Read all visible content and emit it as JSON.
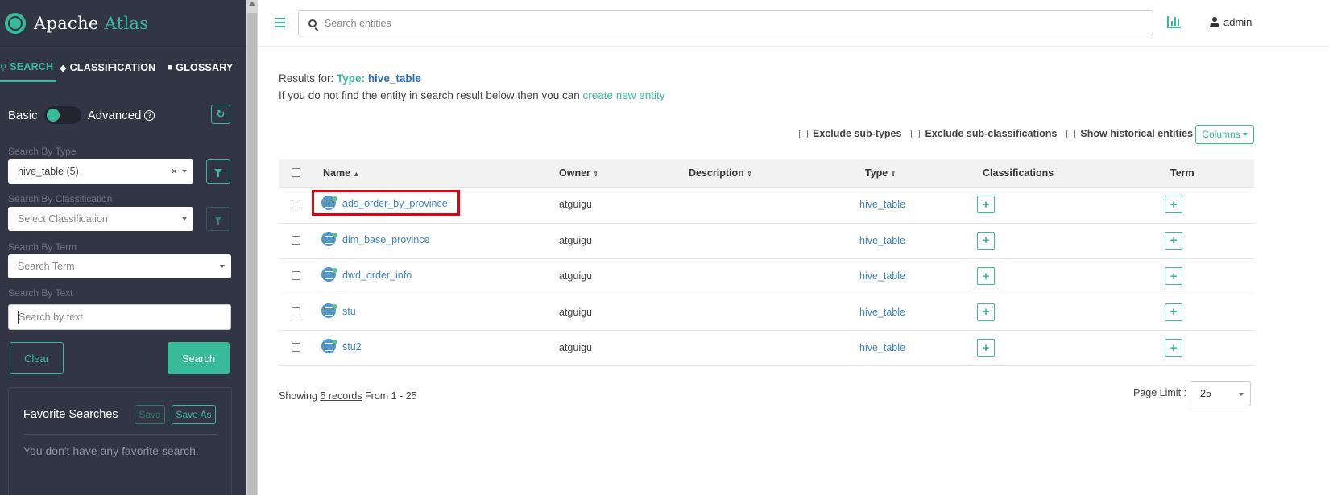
{
  "brand": {
    "name_part1": "Apache ",
    "name_part2": "Atlas"
  },
  "sidebar": {
    "tabs": [
      {
        "label": "SEARCH",
        "icon": "search-icon"
      },
      {
        "label": "CLASSIFICATION",
        "icon": "tag-icon"
      },
      {
        "label": "GLOSSARY",
        "icon": "folder-open-icon"
      }
    ],
    "mode": {
      "basic_label": "Basic",
      "advanced_label": "Advanced"
    },
    "search_by_type_label": "Search By Type",
    "type_value": "hive_table (5)",
    "search_by_classification_label": "Search By Classification",
    "classification_placeholder": "Select Classification",
    "search_by_term_label": "Search By Term",
    "term_placeholder": "Search Term",
    "search_by_text_label": "Search By Text",
    "text_placeholder": "Search by text",
    "clear_label": "Clear",
    "search_label": "Search",
    "favorites": {
      "title": "Favorite Searches",
      "save_label": "Save",
      "save_as_label": "Save As",
      "empty_text": "You don't have any favorite search."
    }
  },
  "header": {
    "search_placeholder": "Search entities",
    "user_label": "admin"
  },
  "results": {
    "prefix": "Results for: ",
    "type_key": "Type:",
    "type_value": "hive_table",
    "hint_text": "If you do not find the entity in search result below then you can ",
    "hint_link": "create new entity",
    "options": [
      "Exclude sub-types",
      "Exclude sub-classifications",
      "Show historical entities"
    ],
    "columns_label": "Columns"
  },
  "table": {
    "headers": [
      "Name",
      "Owner",
      "Description",
      "Type",
      "Classifications",
      "Term"
    ],
    "rows": [
      {
        "name": "ads_order_by_province",
        "owner": "atguigu",
        "description": "",
        "type": "hive_table"
      },
      {
        "name": "dim_base_province",
        "owner": "atguigu",
        "description": "",
        "type": "hive_table"
      },
      {
        "name": "dwd_order_info",
        "owner": "atguigu",
        "description": "",
        "type": "hive_table"
      },
      {
        "name": "stu",
        "owner": "atguigu",
        "description": "",
        "type": "hive_table"
      },
      {
        "name": "stu2",
        "owner": "atguigu",
        "description": "",
        "type": "hive_table"
      }
    ]
  },
  "footer": {
    "showing_prefix": "Showing ",
    "showing_link": "5 records",
    "showing_suffix": " From 1 - 25",
    "page_limit_label": "Page Limit :",
    "page_limit_value": "25"
  },
  "colors": {
    "accent": "#37bb9b",
    "sidebar_bg": "#323544",
    "link": "#3d84c6",
    "highlight": "#e3000f"
  }
}
